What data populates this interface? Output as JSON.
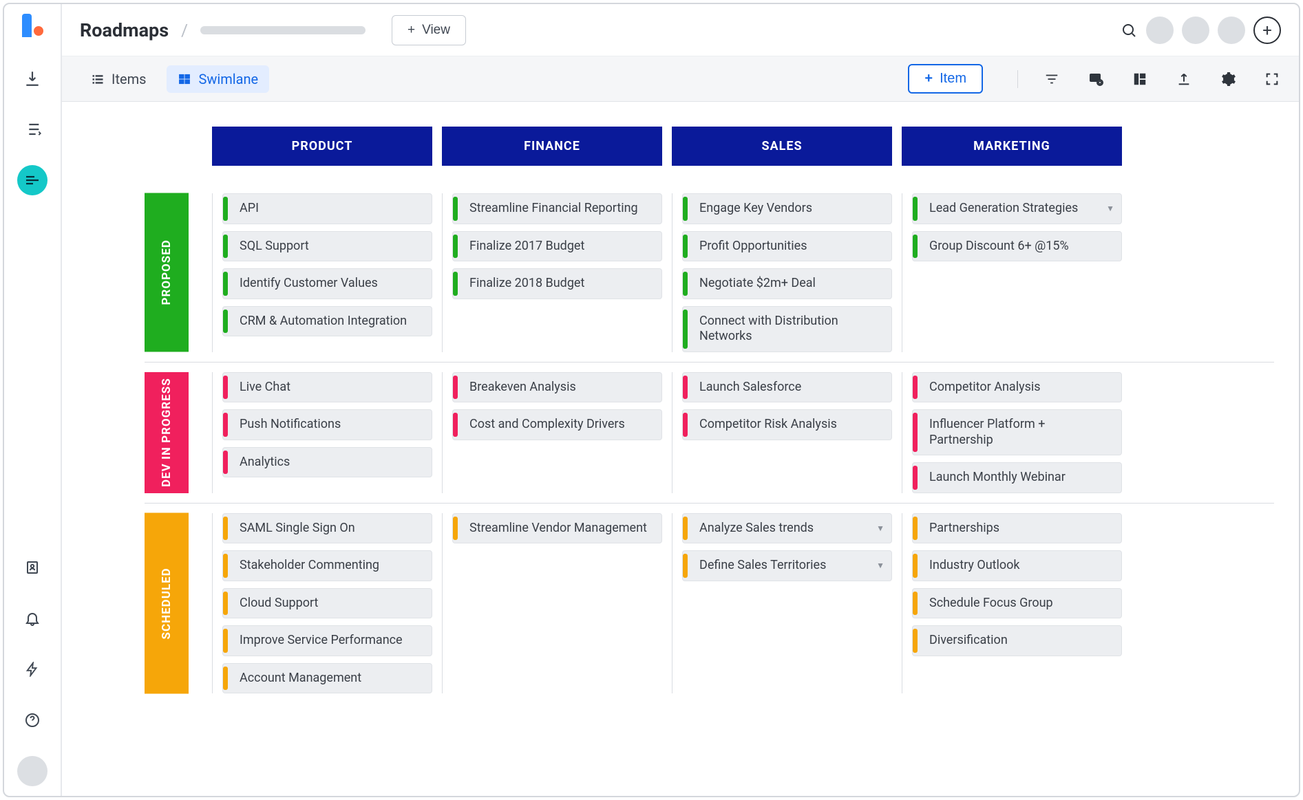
{
  "header": {
    "title": "Roadmaps",
    "view_button": "View"
  },
  "subbar": {
    "items_tab": "Items",
    "swimlane_tab": "Swimlane",
    "add_item": "Item"
  },
  "columns": [
    "PRODUCT",
    "FINANCE",
    "SALES",
    "MARKETING"
  ],
  "lanes": [
    {
      "id": "proposed",
      "label": "PROPOSED",
      "color": "green",
      "cells": [
        [
          "API",
          "SQL Support",
          "Identify Customer Values",
          "CRM & Automation Integration"
        ],
        [
          "Streamline Financial Reporting",
          "Finalize 2017 Budget",
          "Finalize 2018 Budget"
        ],
        [
          "Engage Key Vendors",
          "Profit Opportunities",
          "Negotiate $2m+ Deal",
          "Connect with Distribution Networks"
        ],
        [
          "Lead Generation Strategies",
          "Group Discount 6+ @15%"
        ]
      ],
      "chevrons": {
        "3": [
          0
        ]
      }
    },
    {
      "id": "dev",
      "label": "DEV IN PROGRESS",
      "color": "pink",
      "cells": [
        [
          "Live Chat",
          "Push Notifications",
          "Analytics"
        ],
        [
          "Breakeven Analysis",
          "Cost and Complexity Drivers"
        ],
        [
          "Launch Salesforce",
          "Competitor Risk Analysis"
        ],
        [
          "Competitor Analysis",
          "Influencer Platform + Partnership",
          "Launch Monthly Webinar"
        ]
      ]
    },
    {
      "id": "scheduled",
      "label": "SCHEDULED",
      "color": "orange",
      "cells": [
        [
          "SAML Single Sign On",
          "Stakeholder Commenting",
          "Cloud Support",
          "Improve Service Performance",
          "Account Management"
        ],
        [
          "Streamline Vendor Management"
        ],
        [
          "Analyze Sales trends",
          "Define Sales Territories"
        ],
        [
          "Partnerships",
          "Industry Outlook",
          "Schedule Focus Group",
          "Diversification"
        ]
      ],
      "chevrons": {
        "2": [
          0,
          1
        ]
      }
    }
  ]
}
